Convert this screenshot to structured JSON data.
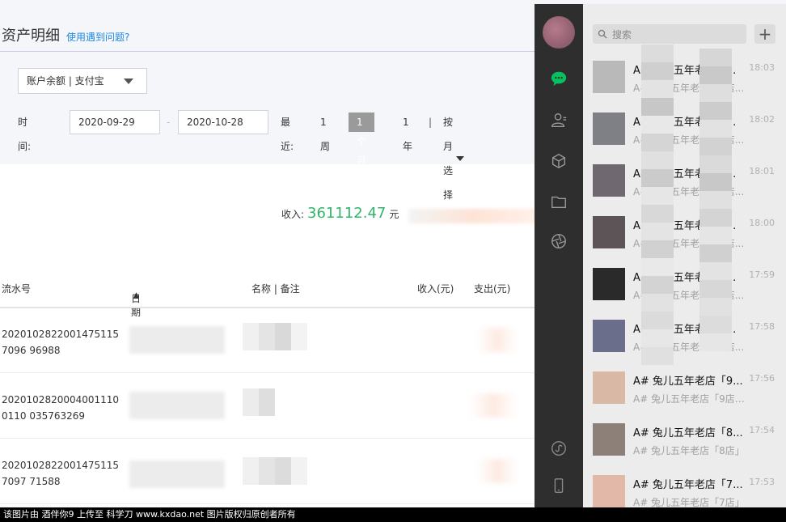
{
  "alipay": {
    "title": "资产明细",
    "help_link": "使用遇到问题?",
    "account_select": "账户余额 | 支付宝",
    "time_label": "时间:",
    "date_from": "2020-09-29",
    "date_to": "2020-10-28",
    "date_sep": "-",
    "recent_label": "最近:",
    "quick_week": "1周",
    "quick_month": "1个月",
    "quick_year": "1年",
    "quick_bar": "|",
    "quick_by_month": "按月选择",
    "income_label": "收入:",
    "income_value": "361112.47",
    "income_unit": "元",
    "table": {
      "headers": {
        "serial": "流水号",
        "date": "日期",
        "name": "名称 | 备注",
        "income": "收入(元)",
        "expense": "支出(元)"
      },
      "rows": [
        {
          "serial": "20201028220014751157096 96988"
        },
        {
          "serial": "20201028200040011100110 035763269"
        },
        {
          "serial": "20201028220014751157097 71588"
        }
      ]
    }
  },
  "wechat": {
    "search_placeholder": "搜索",
    "add_label": "+",
    "chats": [
      {
        "name": "A# 兔儿五年老店「...",
        "preview": "A# 兔儿五年老店「6店...",
        "time": "18:03",
        "avatar_color": "#b9b9b9"
      },
      {
        "name": "A# 兔儿五年老店「...",
        "preview": "A# 兔儿五年老店「2店...",
        "time": "18:02",
        "avatar_color": "#7f7f86"
      },
      {
        "name": "A# 兔儿五年老店「...",
        "preview": "A# 兔儿五年老店「3店...",
        "time": "18:01",
        "avatar_color": "#6f6870"
      },
      {
        "name": "A# 兔儿五年老店「...",
        "preview": "A# 兔儿五年老店「4店...",
        "time": "18:00",
        "avatar_color": "#5d5458"
      },
      {
        "name": "A# 兔儿五年老店「...",
        "preview": "A# 兔儿五年老店「5店...",
        "time": "17:59",
        "avatar_color": "#2a2a2a"
      },
      {
        "name": "A# 兔儿五年老店「...",
        "preview": "A# 兔儿五年老店「1店...",
        "time": "17:58",
        "avatar_color": "#6b6e8a"
      },
      {
        "name": "A# 兔儿五年老店「9...",
        "preview": "A# 兔儿五年老店「9店」...",
        "time": "17:56",
        "avatar_color": "#d9b8a6"
      },
      {
        "name": "A# 兔儿五年老店「8...",
        "preview": "A# 兔儿五年老店「8店」",
        "time": "17:54",
        "avatar_color": "#8c8078"
      },
      {
        "name": "A# 兔儿五年老店「7...",
        "preview": "A# 兔儿五年老店「7店」",
        "time": "17:53",
        "avatar_color": "#e2b9a8"
      }
    ]
  },
  "footer": "该图片由 酒伴你9 上传至 科学刀 www.kxdao.net 图片版权归原创者所有"
}
